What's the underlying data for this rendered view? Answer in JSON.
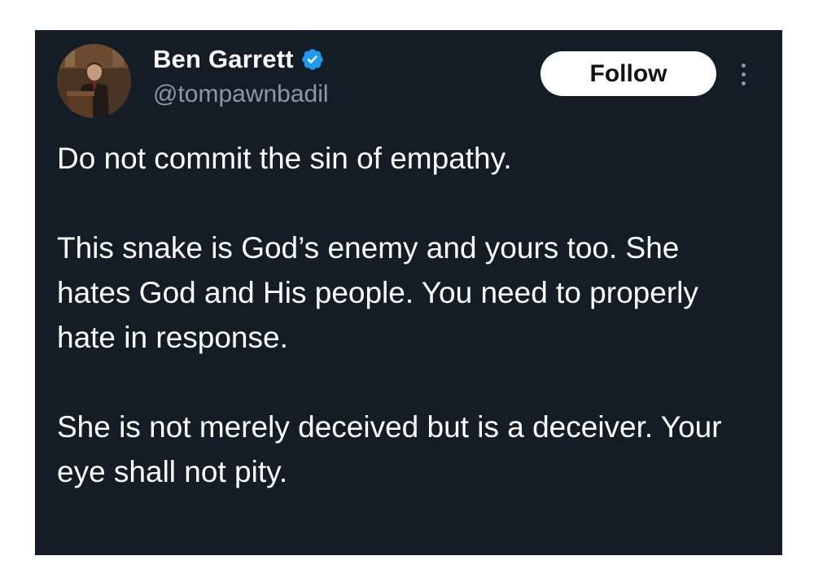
{
  "author": {
    "name": "Ben Garrett",
    "handle": "@tompawnbadil",
    "verified": true,
    "verified_color": "#1d9bf0",
    "avatar_icon": "person-at-podium-avatar"
  },
  "actions": {
    "follow_label": "Follow",
    "more_icon": "more-vertical-icon"
  },
  "tweet": {
    "paragraphs": [
      "Do not commit the sin of empathy.",
      "This snake is God’s enemy and yours too. She hates God and His people. You need to properly hate in response.",
      "She is not merely deceived but is a deceiver. Your eye shall not pity."
    ]
  },
  "colors": {
    "background": "#141d26",
    "text": "#ffffff",
    "secondary_text": "#8b98a5"
  }
}
